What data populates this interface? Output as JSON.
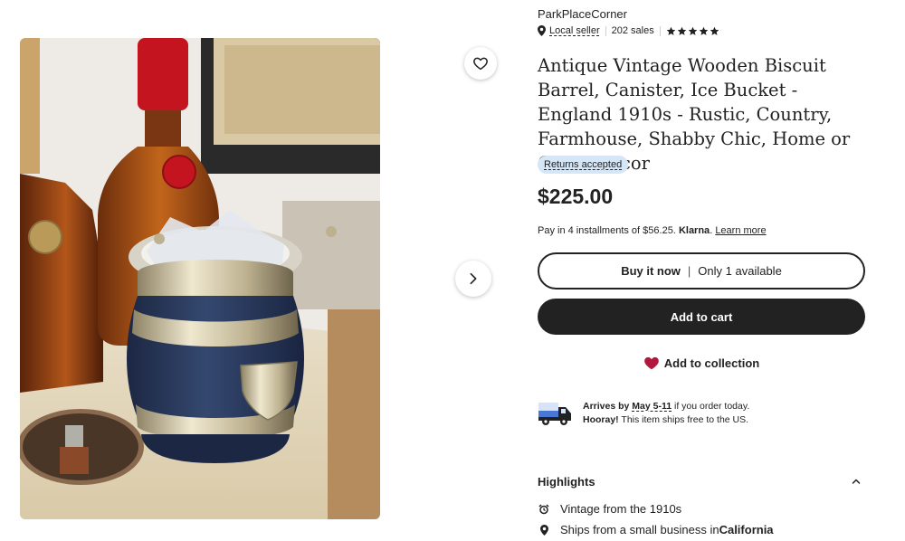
{
  "listing": {
    "shop_name": "ParkPlaceCorner",
    "local_seller_label": "Local seller",
    "sales_count": "202 sales",
    "rating_stars": 5,
    "title": "Antique Vintage Wooden Biscuit Barrel, Canister, Ice Bucket - England 1910s - Rustic, Country, Farmhouse, Shabby Chic, Home or Office Decor",
    "returns_badge": "Returns accepted",
    "price": "$225.00",
    "klarna": {
      "prefix": "Pay in 4 installments of $56.25. ",
      "brand": "Klarna",
      "suffix": ". ",
      "learn_more": "Learn more"
    }
  },
  "actions": {
    "buy_now": "Buy it now",
    "separator": "|",
    "availability": "Only 1 available",
    "add_to_cart": "Add to cart",
    "add_to_collection": "Add to collection"
  },
  "shipping": {
    "arrives_prefix": "Arrives by ",
    "arrives_date": "May 5-11",
    "arrives_suffix": " if you order today.",
    "hooray": "Hooray!",
    "free_shipping": " This item ships free to the US."
  },
  "highlights": {
    "title": "Highlights",
    "vintage": "Vintage from the 1910s",
    "ships_prefix": "Ships from a small business in ",
    "ships_location": "California"
  },
  "icons": {
    "favorite": "heart-outline-icon",
    "next": "chevron-right-icon",
    "location": "location-pin-icon",
    "star": "star-icon",
    "collection": "heart-filled-icon",
    "truck": "delivery-truck-icon",
    "collapse": "chevron-up-icon",
    "vintage": "alarm-clock-icon"
  },
  "colors": {
    "primary_button": "#222222",
    "returns_badge_bg": "#d5e6f7",
    "collection_heart": "#b3173d",
    "truck_blue": "#4a77d4"
  }
}
